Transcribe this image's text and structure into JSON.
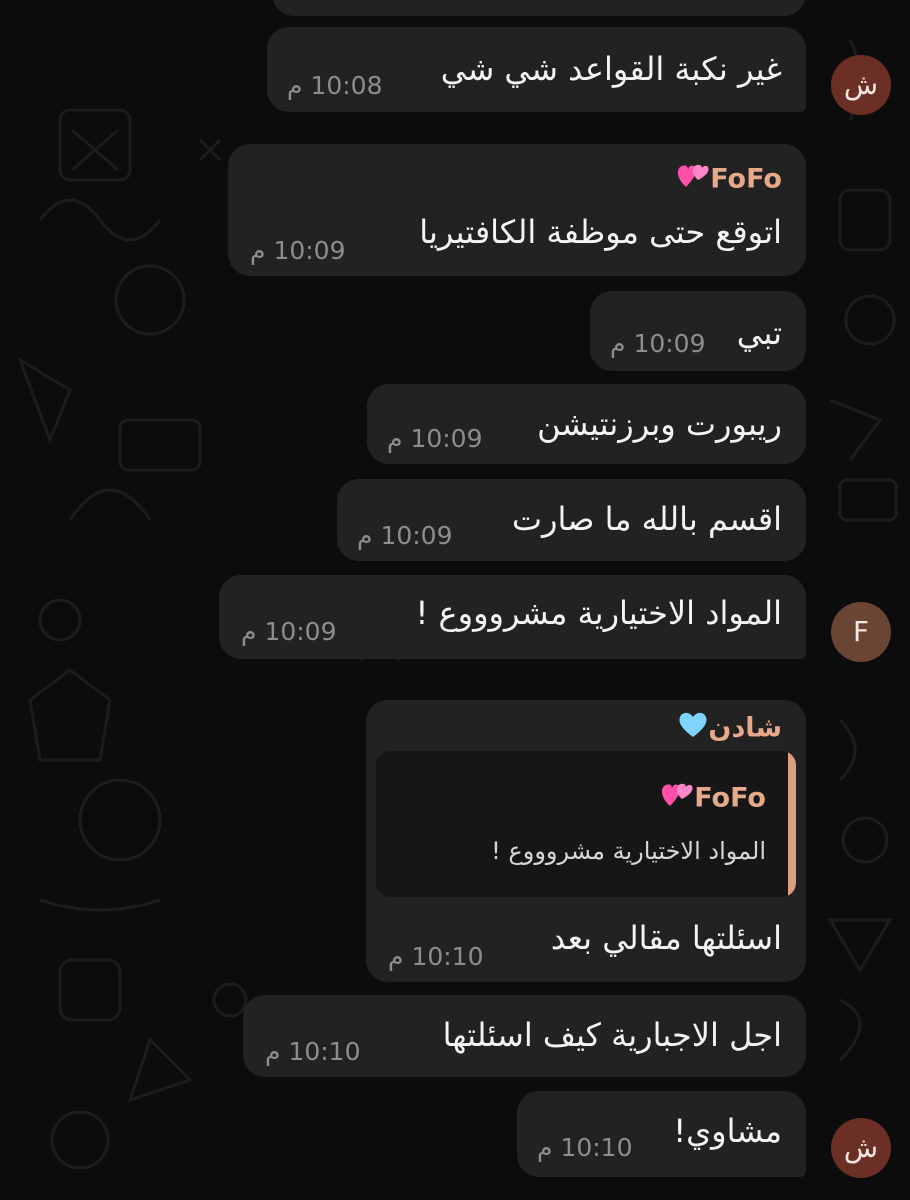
{
  "colors": {
    "background": "#0c0c0c",
    "bubble": "#222223",
    "sender_name": "#e7a98a",
    "time": "#8d8d8f",
    "reply_bar": "#dba07d"
  },
  "avatars": {
    "shaden": "ش",
    "fofo": "F"
  },
  "messages": [
    {
      "text": "غير نكبة القواعد شي شي",
      "time": "10:08 م"
    },
    {
      "sender": "FoFo",
      "sender_icon": "hearts-icon",
      "text": "اتوقع حتى موظفة الكافتيريا",
      "time": "10:09 م"
    },
    {
      "text": "تبي",
      "time": "10:09 م"
    },
    {
      "text": "ريبورت وبرزنتيشن",
      "time": "10:09 م"
    },
    {
      "text": "اقسم بالله ما صارت",
      "time": "10:09 م"
    },
    {
      "text": "المواد الاختيارية مشروووع !",
      "time": "10:09 م"
    },
    {
      "sender": "شادن",
      "sender_icon": "blue-heart-icon",
      "reply": {
        "sender": "FoFo",
        "text": "المواد الاختيارية مشروووع !"
      },
      "text": "اسئلتها مقالي بعد",
      "time": "10:10 م"
    },
    {
      "text": "اجل الاجبارية كيف اسئلتها",
      "time": "10:10 م"
    },
    {
      "text": "مشاوي!",
      "time": "10:10 م"
    }
  ]
}
